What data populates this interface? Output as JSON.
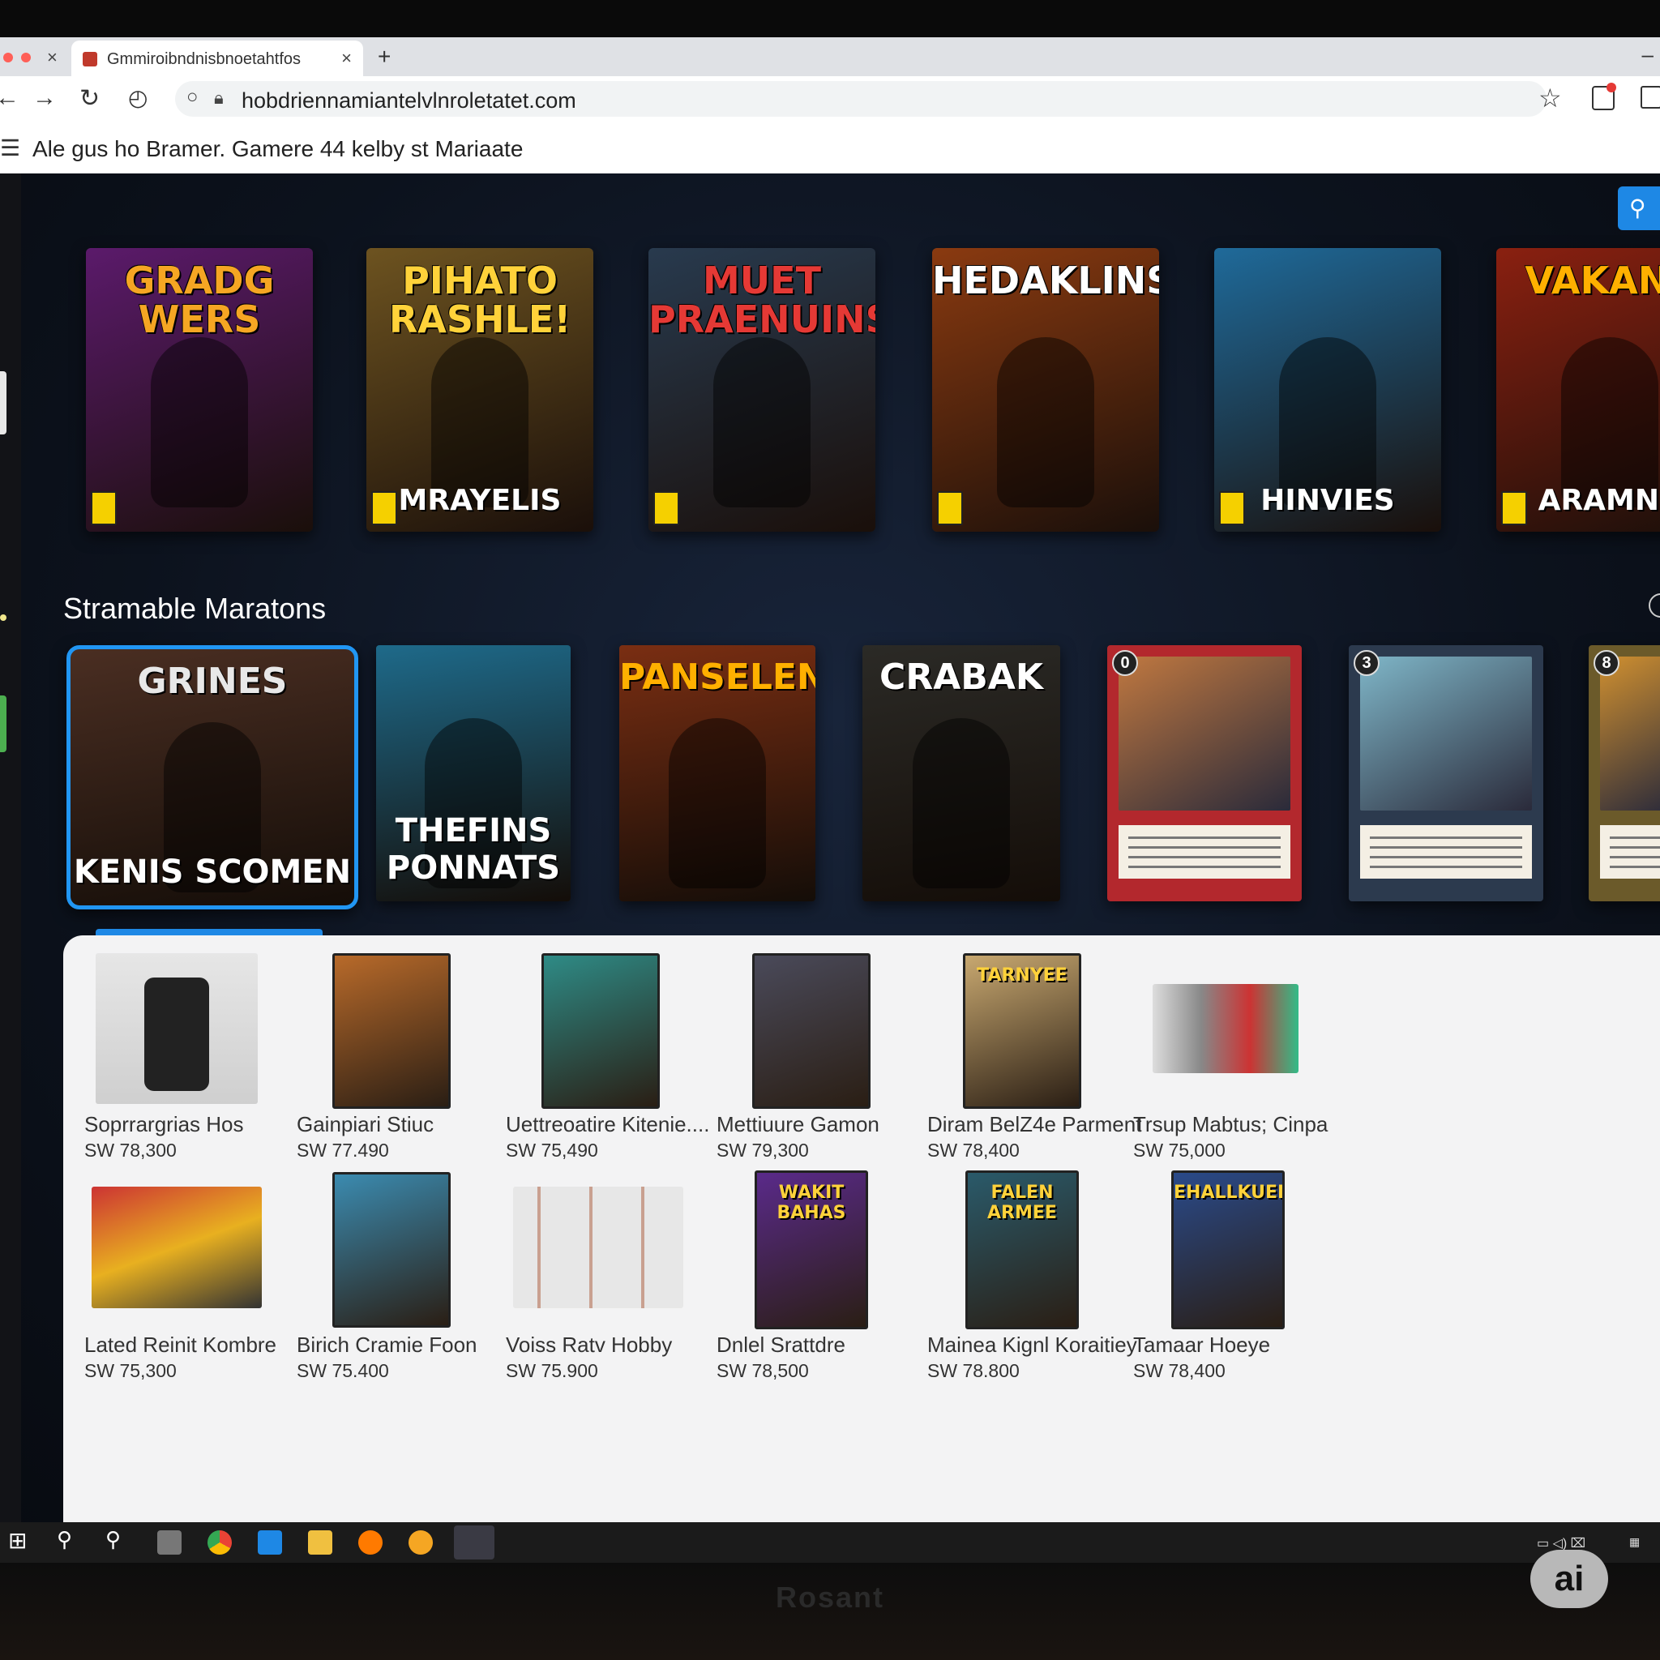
{
  "browser": {
    "tab_title": "Gmmiroibndnisbnoetahtfos",
    "url": "hobdriennamiantelvlnroletatet.com"
  },
  "site": {
    "header_title": "Ale gus ho Bramer. Gamere 44 kelby st Mariaate"
  },
  "hero_posters": [
    {
      "title": "GRADG WERS",
      "subtitle": "",
      "bg": "#5b1a6b",
      "accent": "#f5a623"
    },
    {
      "title": "PIHATO RASHLE!",
      "subtitle": "MRAYELIS",
      "bg": "#6d5320",
      "accent": "#ffd23a"
    },
    {
      "title": "MUET PRAENUINS",
      "subtitle": "",
      "bg": "#283a4e",
      "accent": "#e53935"
    },
    {
      "title": "HEDAKLINS",
      "subtitle": "",
      "bg": "#8a3a10",
      "accent": "#ffffff"
    },
    {
      "title": "",
      "subtitle": "HINVIES",
      "bg": "#1f6a9a",
      "accent": "#ffffff"
    },
    {
      "title": "VAKANE",
      "subtitle": "ARAMNB",
      "bg": "#8a2010",
      "accent": "#ffb000"
    }
  ],
  "section": {
    "title": "Stramable Maratons"
  },
  "cards": [
    {
      "title": "GRINES",
      "bottom": "KENIS SCOMEN",
      "bg": "#4a2e22",
      "accent": "#e8e8e8",
      "type": "poster"
    },
    {
      "title": "",
      "bottom": "THEFINS PONNATS",
      "bg": "#1e6a8a",
      "accent": "#ffd23a",
      "type": "poster"
    },
    {
      "title": "PANSELENS",
      "bottom": "",
      "bg": "#7a2e12",
      "accent": "#ffb000",
      "type": "poster"
    },
    {
      "title": "CRABAK",
      "bottom": "",
      "bg": "#2b2a26",
      "accent": "#ffffff",
      "type": "poster"
    },
    {
      "cost": "0",
      "bg": "#b3282d",
      "art": "#c07840",
      "type": "tcg"
    },
    {
      "cost": "3",
      "bg": "#2c3a4e",
      "art": "#7fb6c8",
      "type": "tcg"
    },
    {
      "cost": "8",
      "bg": "#6b5a2a",
      "art": "#d09030",
      "type": "tcg"
    }
  ],
  "products": [
    {
      "name": "Soprrargrias Hos",
      "price": "SW 78,300",
      "kind": "figure",
      "color": "#333"
    },
    {
      "name": "Gainpiari Stiuc",
      "price": "SW 77.490",
      "kind": "card",
      "color": "#b86a2a"
    },
    {
      "name": "Uettreoatire Kitenie....",
      "price": "SW 75,490",
      "kind": "card",
      "color": "#2e8b86"
    },
    {
      "name": "Mettiuure Gamon",
      "price": "SW 79,300",
      "kind": "card",
      "color": "#4a4a5a"
    },
    {
      "name": "Diram BelZ4e Parment",
      "price": "SW 78,400",
      "kind": "card",
      "color": "#c8a870"
    },
    {
      "name": "Trsup Mabtus; Cinpa",
      "price": "SW 75,000",
      "kind": "kit",
      "color": "#999"
    },
    {
      "name": "Lated Reinit Kombre",
      "price": "SW 75,300",
      "kind": "box",
      "color": "#b33"
    },
    {
      "name": "Birich Cramie Foon",
      "price": "SW 75.400",
      "kind": "card",
      "color": "#3b8bb0"
    },
    {
      "name": "Voiss Ratv Hobby",
      "price": "SW 75.900",
      "kind": "binder",
      "color": "#ccc"
    },
    {
      "name": "Dnlel Srattdre",
      "price": "SW 78,500",
      "kind": "poster",
      "color": "#5a2a8a"
    },
    {
      "name": "Mainea Kignl Koraitiey",
      "price": "SW 78.800",
      "kind": "poster",
      "color": "#2a5a6a"
    },
    {
      "name": "Tamaar Hoeye",
      "price": "SW 78,400",
      "kind": "poster",
      "color": "#2a4a8a"
    }
  ],
  "product_art_labels": [
    "TARNYEE",
    "WAKIT BAHAS",
    "FALEN ARMEE",
    "EHALLKUEN"
  ],
  "monitor": {
    "brand": "Rosant",
    "badge": "ai"
  }
}
